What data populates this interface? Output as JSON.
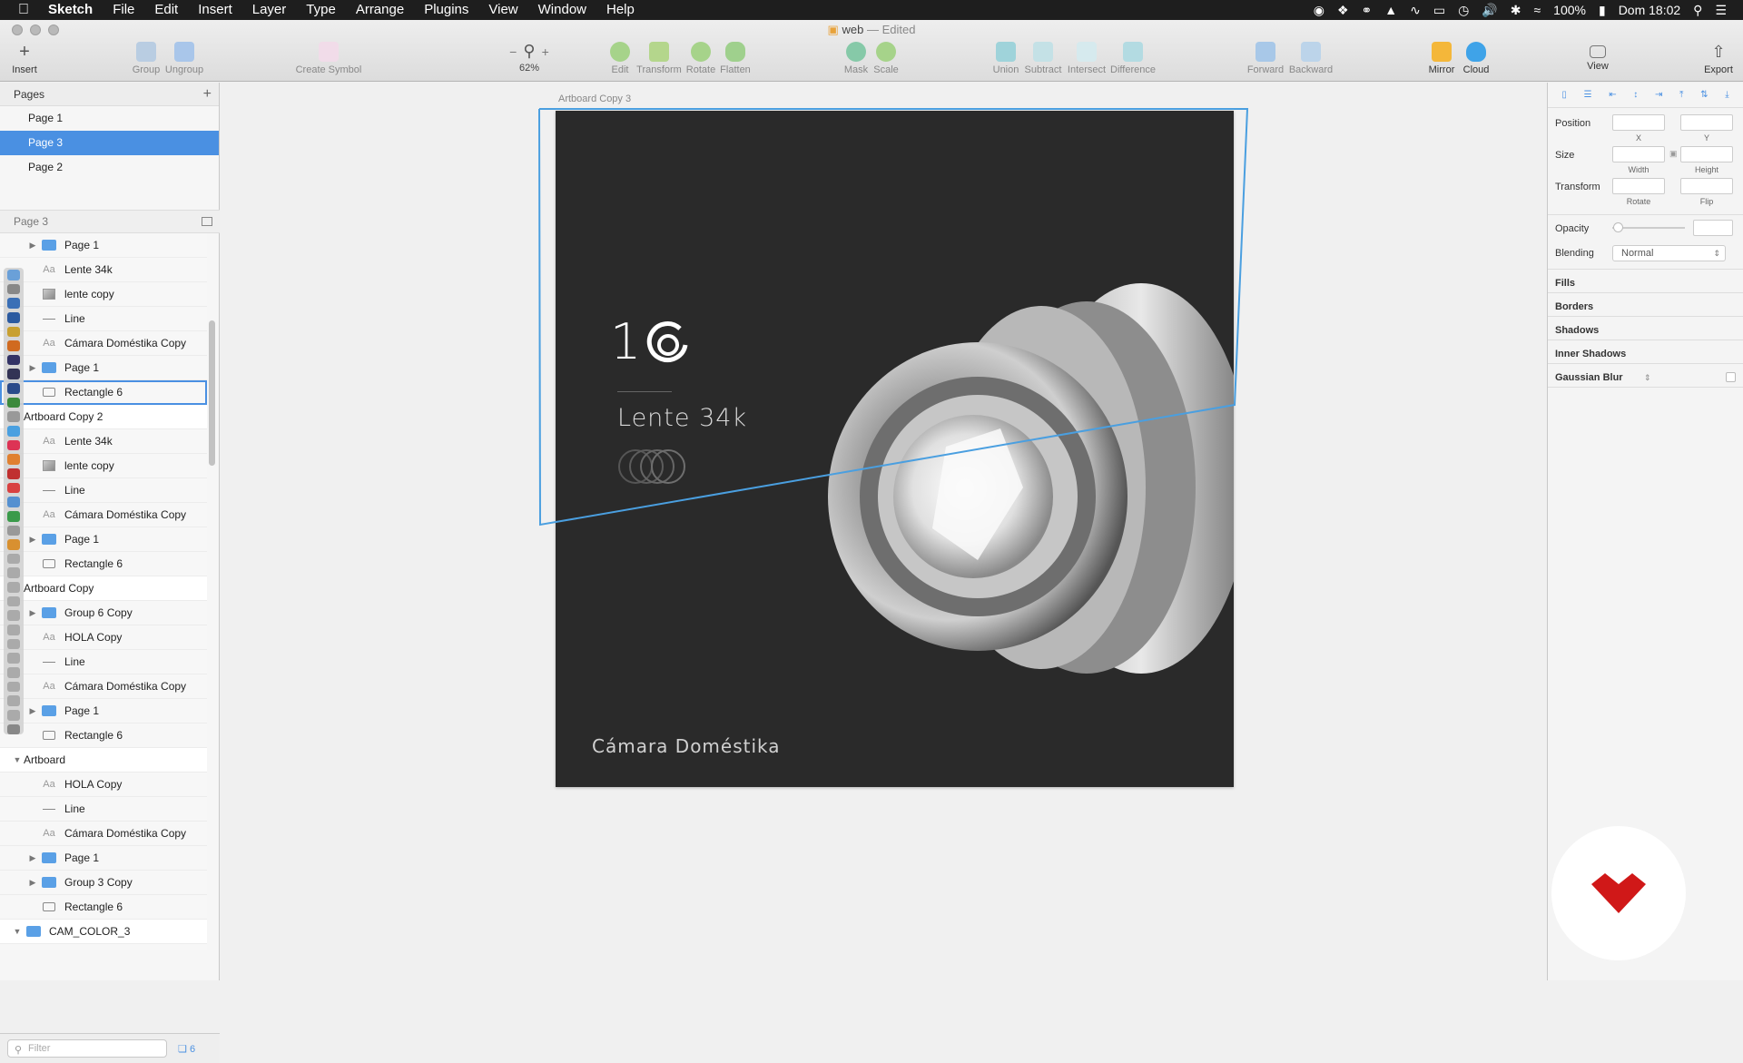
{
  "menubar": {
    "apple": "",
    "app_name": "Sketch",
    "menus": [
      "File",
      "Edit",
      "Insert",
      "Layer",
      "Type",
      "Arrange",
      "Plugins",
      "View",
      "Window",
      "Help"
    ],
    "battery": "100%",
    "clock": "Dom 18:02"
  },
  "window": {
    "doc_name": "web",
    "doc_status": "— Edited"
  },
  "toolbar": {
    "insert": "Insert",
    "group": "Group",
    "ungroup": "Ungroup",
    "create_symbol": "Create Symbol",
    "zoom_minus": "−",
    "zoom_plus": "+",
    "zoom_level": "62%",
    "edit": "Edit",
    "transform": "Transform",
    "rotate": "Rotate",
    "flatten": "Flatten",
    "mask": "Mask",
    "scale": "Scale",
    "union": "Union",
    "subtract": "Subtract",
    "intersect": "Intersect",
    "difference": "Difference",
    "forward": "Forward",
    "backward": "Backward",
    "mirror": "Mirror",
    "cloud": "Cloud",
    "view": "View",
    "export": "Export"
  },
  "pages_panel": {
    "header": "Pages",
    "add": "+",
    "pages": [
      {
        "label": "Page 1",
        "active": false
      },
      {
        "label": "Page 3",
        "active": true
      },
      {
        "label": "Page 2",
        "active": false
      }
    ]
  },
  "layers_panel": {
    "header": "Page 3",
    "layers": [
      {
        "label": "Page 1",
        "kind": "folder",
        "indent": 1,
        "arrow": "▶"
      },
      {
        "label": "Lente 34k",
        "kind": "text",
        "indent": 1,
        "icon": "Aa"
      },
      {
        "label": "lente copy",
        "kind": "image",
        "indent": 1
      },
      {
        "label": "Line",
        "kind": "line",
        "indent": 1
      },
      {
        "label": "Cámara Doméstika Copy",
        "kind": "text",
        "indent": 1,
        "icon": "Aa"
      },
      {
        "label": "Page 1",
        "kind": "folder",
        "indent": 1,
        "arrow": "▶"
      },
      {
        "label": "Rectangle 6",
        "kind": "rect",
        "indent": 1,
        "selected": true
      },
      {
        "label": "Artboard Copy 2",
        "kind": "artboard",
        "indent": 0
      },
      {
        "label": "Lente 34k",
        "kind": "text",
        "indent": 1,
        "icon": "Aa"
      },
      {
        "label": "lente copy",
        "kind": "image",
        "indent": 1
      },
      {
        "label": "Line",
        "kind": "line",
        "indent": 1
      },
      {
        "label": "Cámara Doméstika Copy",
        "kind": "text",
        "indent": 1,
        "icon": "Aa"
      },
      {
        "label": "Page 1",
        "kind": "folder",
        "indent": 1,
        "arrow": "▶"
      },
      {
        "label": "Rectangle 6",
        "kind": "rect",
        "indent": 1
      },
      {
        "label": "Artboard Copy",
        "kind": "artboard",
        "indent": 0
      },
      {
        "label": "Group 6 Copy",
        "kind": "folder",
        "indent": 1,
        "arrow": "▶"
      },
      {
        "label": "HOLA Copy",
        "kind": "text",
        "indent": 1,
        "icon": "Aa"
      },
      {
        "label": "Line",
        "kind": "line",
        "indent": 1
      },
      {
        "label": "Cámara Doméstika Copy",
        "kind": "text",
        "indent": 1,
        "icon": "Aa"
      },
      {
        "label": "Page 1",
        "kind": "folder",
        "indent": 1,
        "arrow": "▶"
      },
      {
        "label": "Rectangle 6",
        "kind": "rect",
        "indent": 1
      },
      {
        "label": "Artboard",
        "kind": "artboard",
        "indent": 0,
        "arrow": "▼"
      },
      {
        "label": "HOLA Copy",
        "kind": "text",
        "indent": 1,
        "icon": "Aa"
      },
      {
        "label": "Line",
        "kind": "line",
        "indent": 1
      },
      {
        "label": "Cámara Doméstika Copy",
        "kind": "text",
        "indent": 1,
        "icon": "Aa"
      },
      {
        "label": "Page 1",
        "kind": "folder",
        "indent": 1,
        "arrow": "▶"
      },
      {
        "label": "Group 3 Copy",
        "kind": "folder",
        "indent": 1,
        "arrow": "▶"
      },
      {
        "label": "Rectangle 6",
        "kind": "rect",
        "indent": 1
      },
      {
        "label": "CAM_COLOR_3",
        "kind": "folder-top",
        "indent": 0,
        "arrow": "▼"
      },
      {
        "label": "CAM_COLOR_3",
        "kind": "image",
        "indent": 1
      }
    ],
    "filter_placeholder": "Filter",
    "filter_count": "6"
  },
  "canvas": {
    "artboard_label": "Artboard Copy 3",
    "logo_text": "1",
    "product_title": "Lente 34k",
    "footer_title": "Cámara Doméstika",
    "background": "#2a2a2a",
    "selection_color": "#4a9fe0"
  },
  "inspector": {
    "position": "Position",
    "x": "X",
    "y": "Y",
    "size": "Size",
    "width": "Width",
    "height": "Height",
    "transform": "Transform",
    "rotate": "Rotate",
    "flip": "Flip",
    "opacity": "Opacity",
    "blending": "Blending",
    "blending_value": "Normal",
    "fills": "Fills",
    "borders": "Borders",
    "shadows": "Shadows",
    "inner_shadows": "Inner Shadows",
    "gaussian_blur": "Gaussian Blur"
  },
  "colors": {
    "accent": "#4a90e2",
    "badge_red": "#d01818"
  }
}
